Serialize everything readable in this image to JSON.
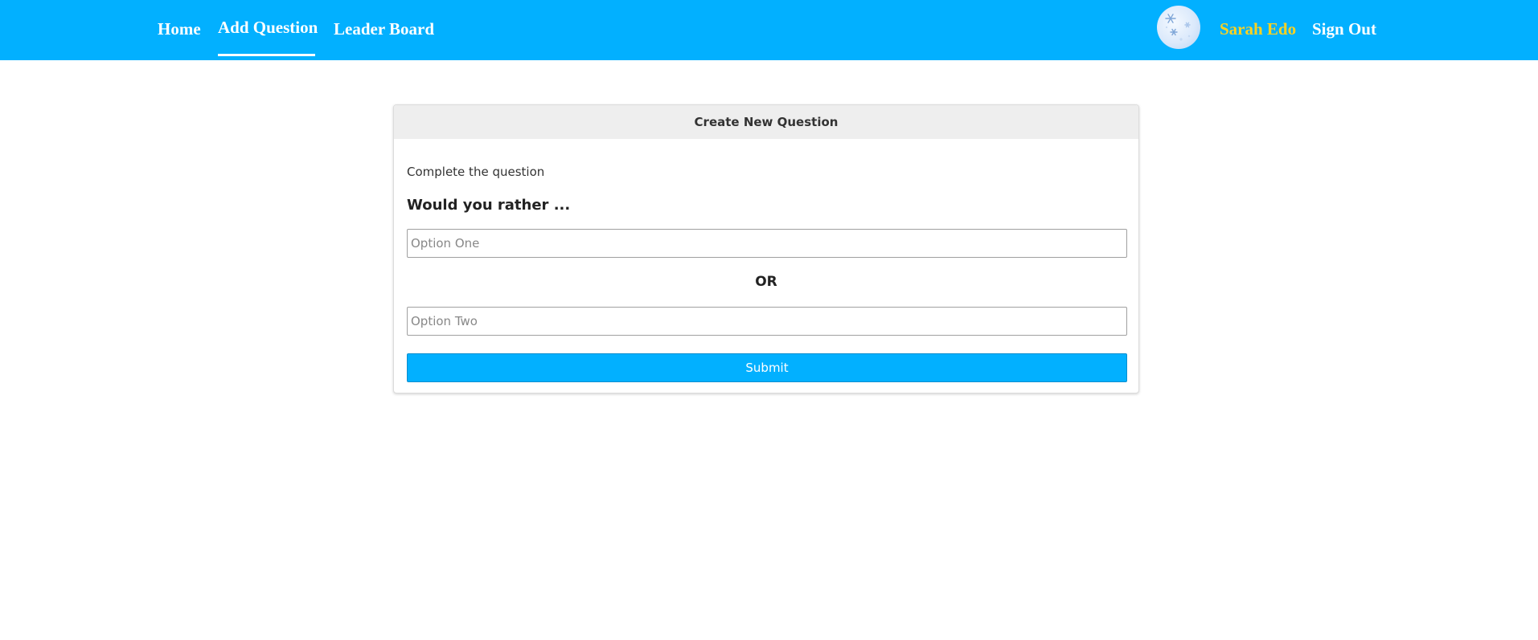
{
  "nav": {
    "home": "Home",
    "add_question": "Add Question",
    "leader_board": "Leader Board",
    "active_tab": "Add Question"
  },
  "user": {
    "name": "Sarah Edo",
    "sign_out": "Sign Out",
    "avatar_icon": "avatar-snowflake-icon"
  },
  "card": {
    "header": "Create New Question",
    "subtitle": "Complete the question",
    "prompt": "Would you rather ...",
    "option_one_placeholder": "Option One",
    "option_one_value": "",
    "or_label": "OR",
    "option_two_placeholder": "Option Two",
    "option_two_value": "",
    "submit_label": "Submit"
  },
  "colors": {
    "navbar": "#02b0ff",
    "username": "#ffd21f",
    "submit": "#02b0ff",
    "card_header": "#eeeeee"
  }
}
